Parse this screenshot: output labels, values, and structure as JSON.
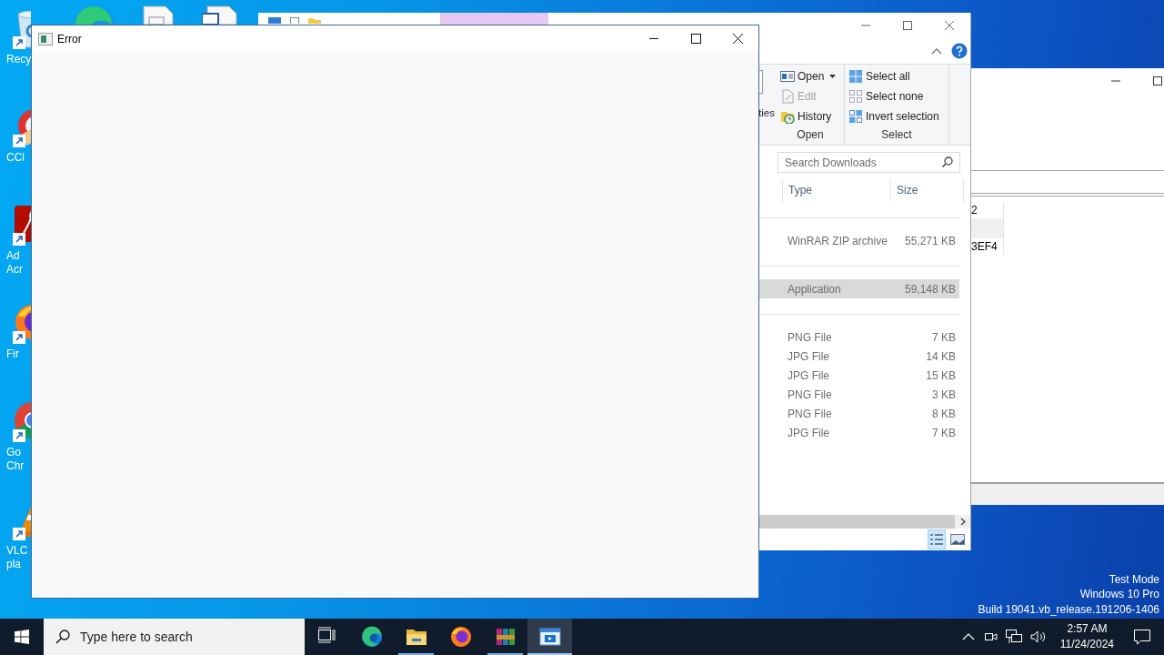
{
  "desktop": {
    "icons": [
      {
        "kind": "recycle-bin",
        "lines": [
          "Recy"
        ]
      },
      {
        "kind": "cleaner",
        "lines": [
          "CCl"
        ]
      },
      {
        "kind": "acrobat",
        "lines": [
          "Ad",
          "Acr"
        ]
      },
      {
        "kind": "firefox",
        "lines": [
          "Fir"
        ]
      },
      {
        "kind": "chrome",
        "lines": [
          "Go",
          "Chr"
        ]
      },
      {
        "kind": "vlc",
        "lines": [
          "VLC",
          "pla"
        ]
      }
    ],
    "system_info": [
      "Test Mode",
      "Windows 10 Pro",
      "Build 19041.vb_release.191206-1406"
    ]
  },
  "explorer_window": {
    "partial_label": "ties",
    "ribbon_groups": [
      {
        "label": "Open",
        "items": [
          {
            "kind": "open",
            "label": "Open",
            "dropdown": true,
            "disabled": false
          },
          {
            "kind": "edit",
            "label": "Edit",
            "dropdown": false,
            "disabled": true
          },
          {
            "kind": "history",
            "label": "History",
            "dropdown": false,
            "disabled": false
          }
        ]
      },
      {
        "label": "Select",
        "items": [
          {
            "kind": "select-all",
            "label": "Select all",
            "dropdown": false,
            "disabled": false
          },
          {
            "kind": "select-none",
            "label": "Select none",
            "dropdown": false,
            "disabled": false
          },
          {
            "kind": "invert",
            "label": "Invert selection",
            "dropdown": false,
            "disabled": false
          }
        ]
      }
    ],
    "search": {
      "placeholder": "Search Downloads"
    },
    "columns": [
      "Type",
      "Size"
    ],
    "groups": [
      {
        "rows": [
          {
            "type": "WinRAR ZIP archive",
            "size": "55,271 KB",
            "selected": false
          }
        ]
      },
      {
        "rows": [
          {
            "type": "Application",
            "size": "59,148 KB",
            "selected": true
          }
        ]
      },
      {
        "rows": [
          {
            "type": "PNG File",
            "size": "7 KB",
            "selected": false
          },
          {
            "type": "JPG File",
            "size": "14 KB",
            "selected": false
          },
          {
            "type": "JPG File",
            "size": "15 KB",
            "selected": false
          },
          {
            "type": "PNG File",
            "size": "3 KB",
            "selected": false
          },
          {
            "type": "PNG File",
            "size": "8 KB",
            "selected": false
          },
          {
            "type": "JPG File",
            "size": "7 KB",
            "selected": false
          }
        ]
      }
    ],
    "view_buttons": [
      {
        "kind": "details",
        "selected": true
      },
      {
        "kind": "large-icons",
        "selected": false
      }
    ]
  },
  "back_window": {
    "rows": [
      {
        "text": "2",
        "highlighted": false
      },
      {
        "highlighted": true
      },
      {
        "text": "3EF4",
        "highlighted": false
      }
    ]
  },
  "error_window": {
    "title": "Error"
  },
  "taskbar": {
    "search": {
      "placeholder": "Type here to search"
    },
    "apps": [
      {
        "kind": "task-view",
        "running": false,
        "active": false
      },
      {
        "kind": "edge",
        "running": false,
        "active": false
      },
      {
        "kind": "explorer",
        "running": true,
        "active": false
      },
      {
        "kind": "firefox",
        "running": false,
        "active": false
      },
      {
        "kind": "winrar",
        "running": true,
        "active": false
      },
      {
        "kind": "app",
        "running": true,
        "active": true
      }
    ],
    "clock": {
      "time": "2:57 AM",
      "date": "11/24/2024"
    }
  }
}
